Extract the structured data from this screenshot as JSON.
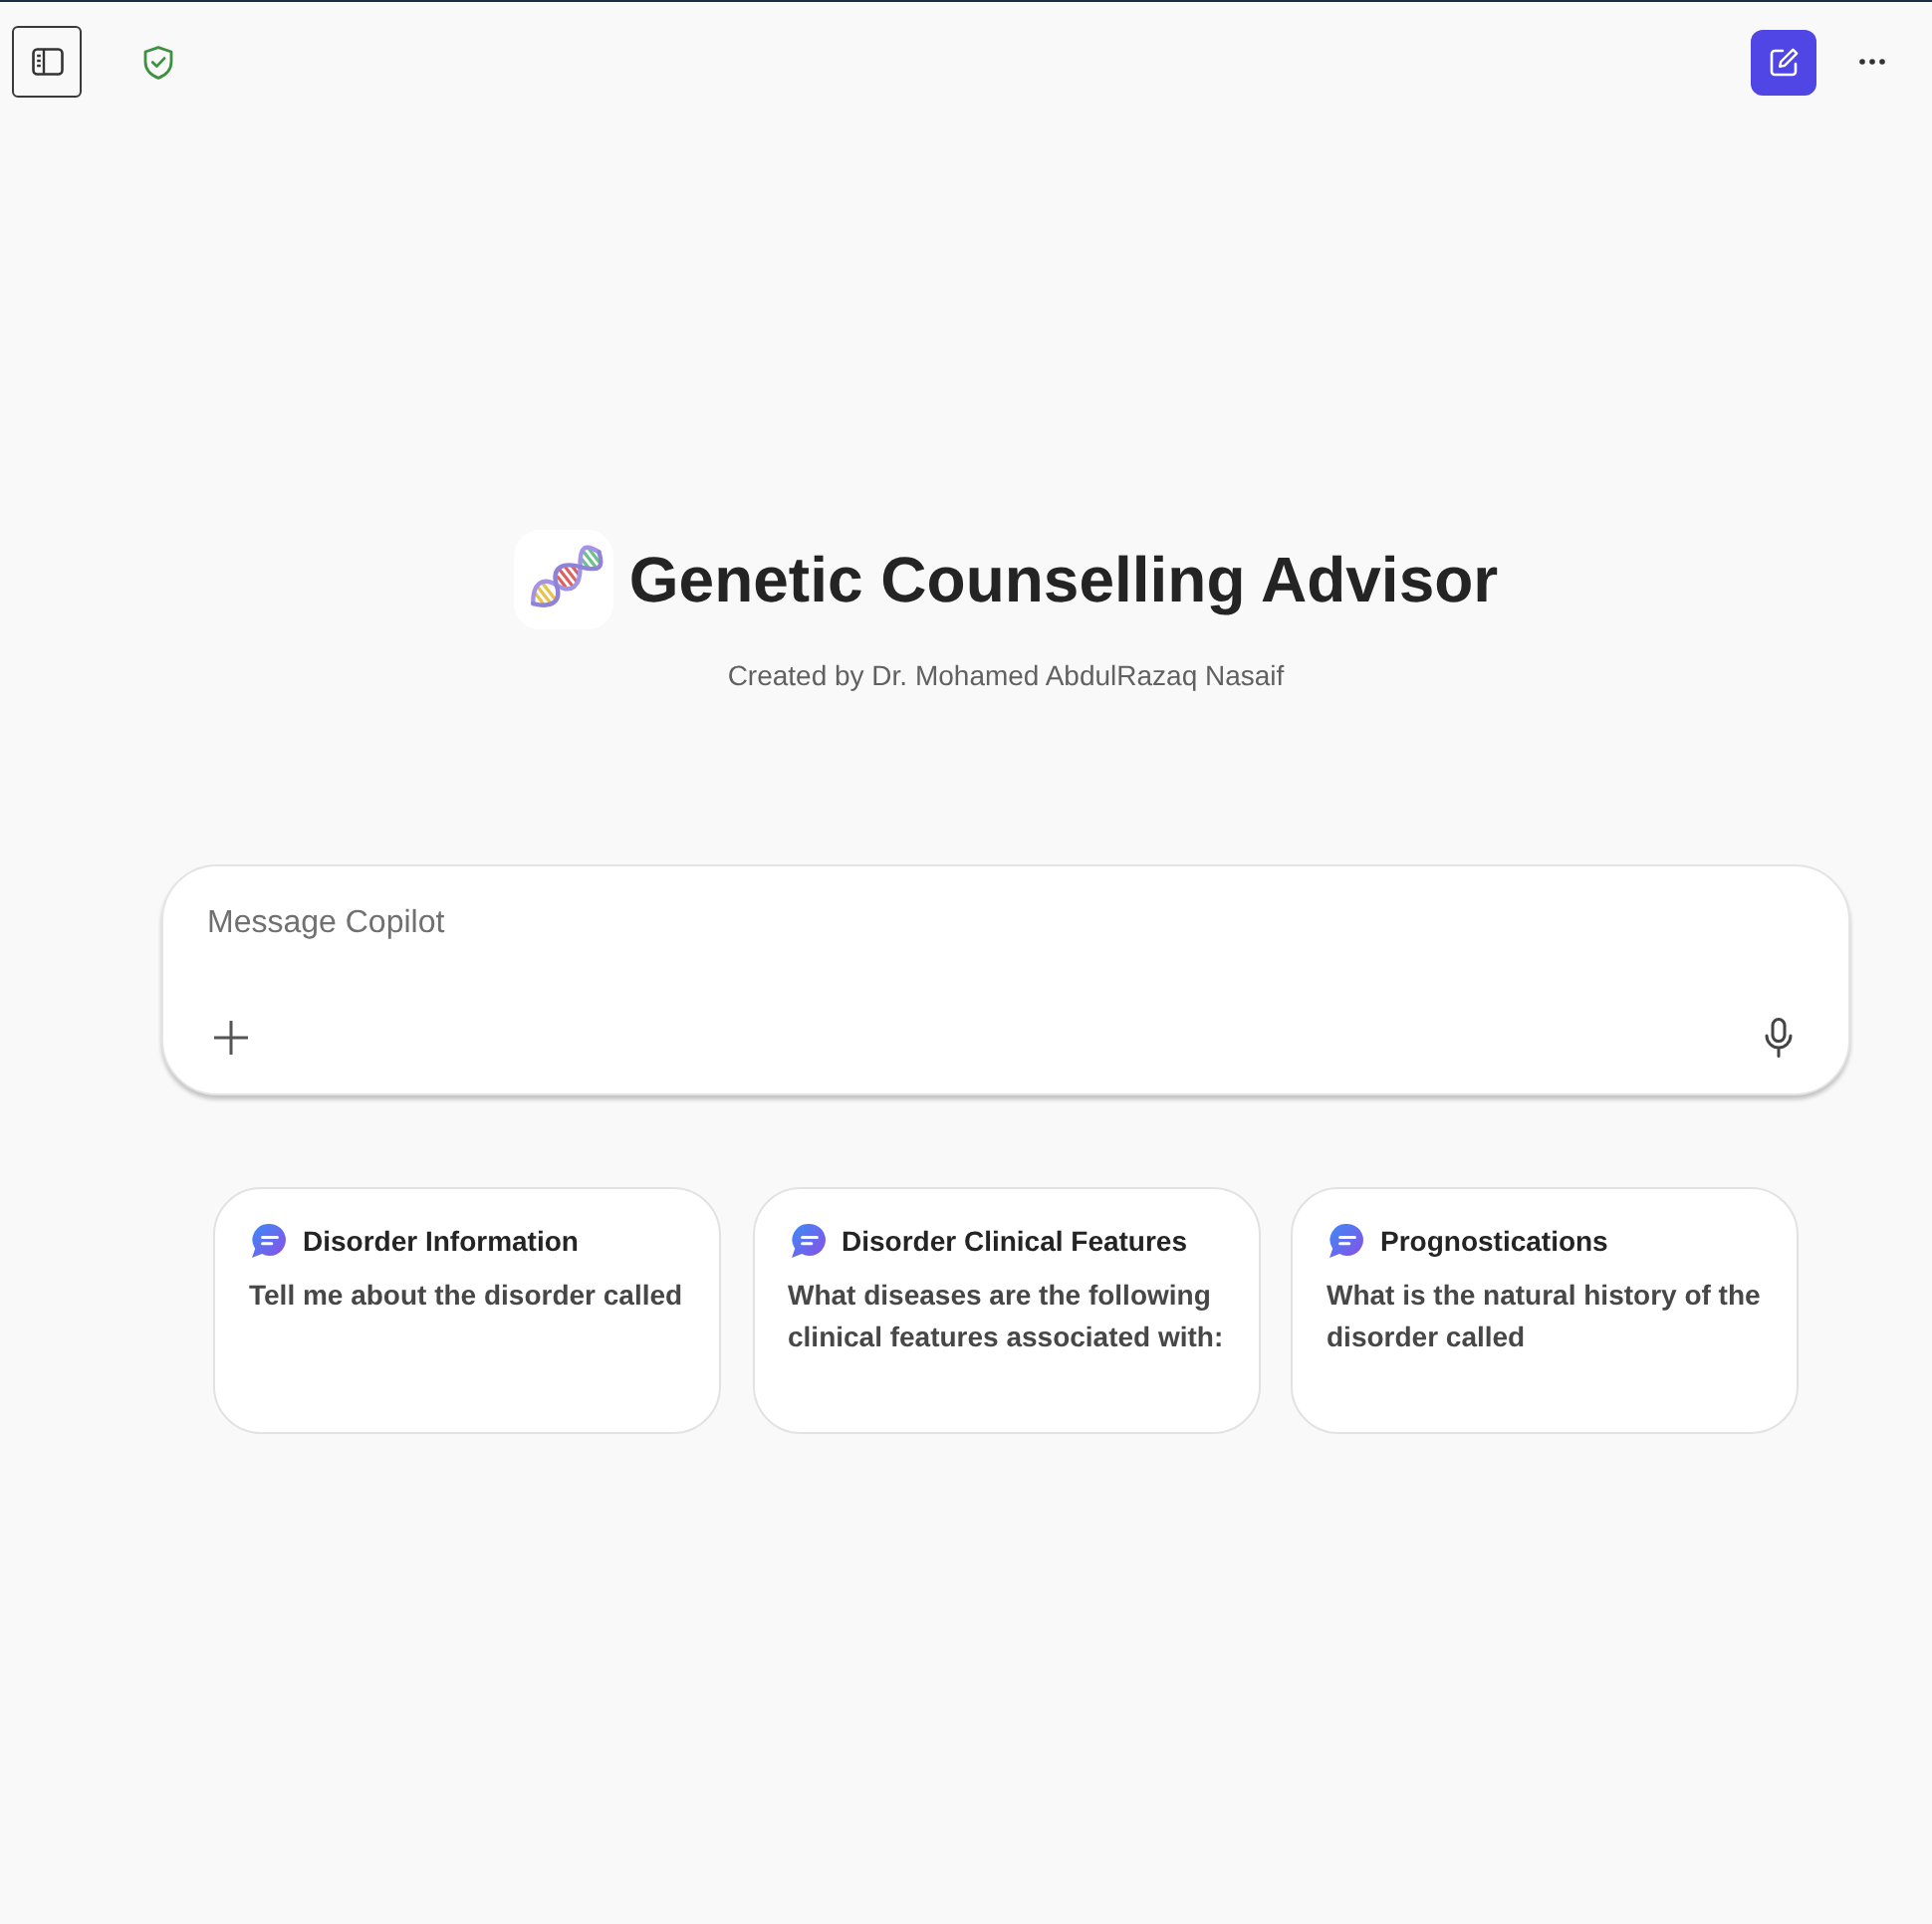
{
  "header": {
    "title": "Genetic Counselling Advisor",
    "subtitle": "Created by Dr. Mohamed AbdulRazaq Nasaif"
  },
  "composer": {
    "placeholder": "Message Copilot"
  },
  "suggestions": [
    {
      "title": "Disorder Information",
      "prompt": "Tell me about the disorder called"
    },
    {
      "title": "Disorder Clinical Features",
      "prompt": "What diseases are the following clinical features associated with:"
    },
    {
      "title": "Prognostications",
      "prompt": "What is the natural history of the disorder called"
    }
  ]
}
